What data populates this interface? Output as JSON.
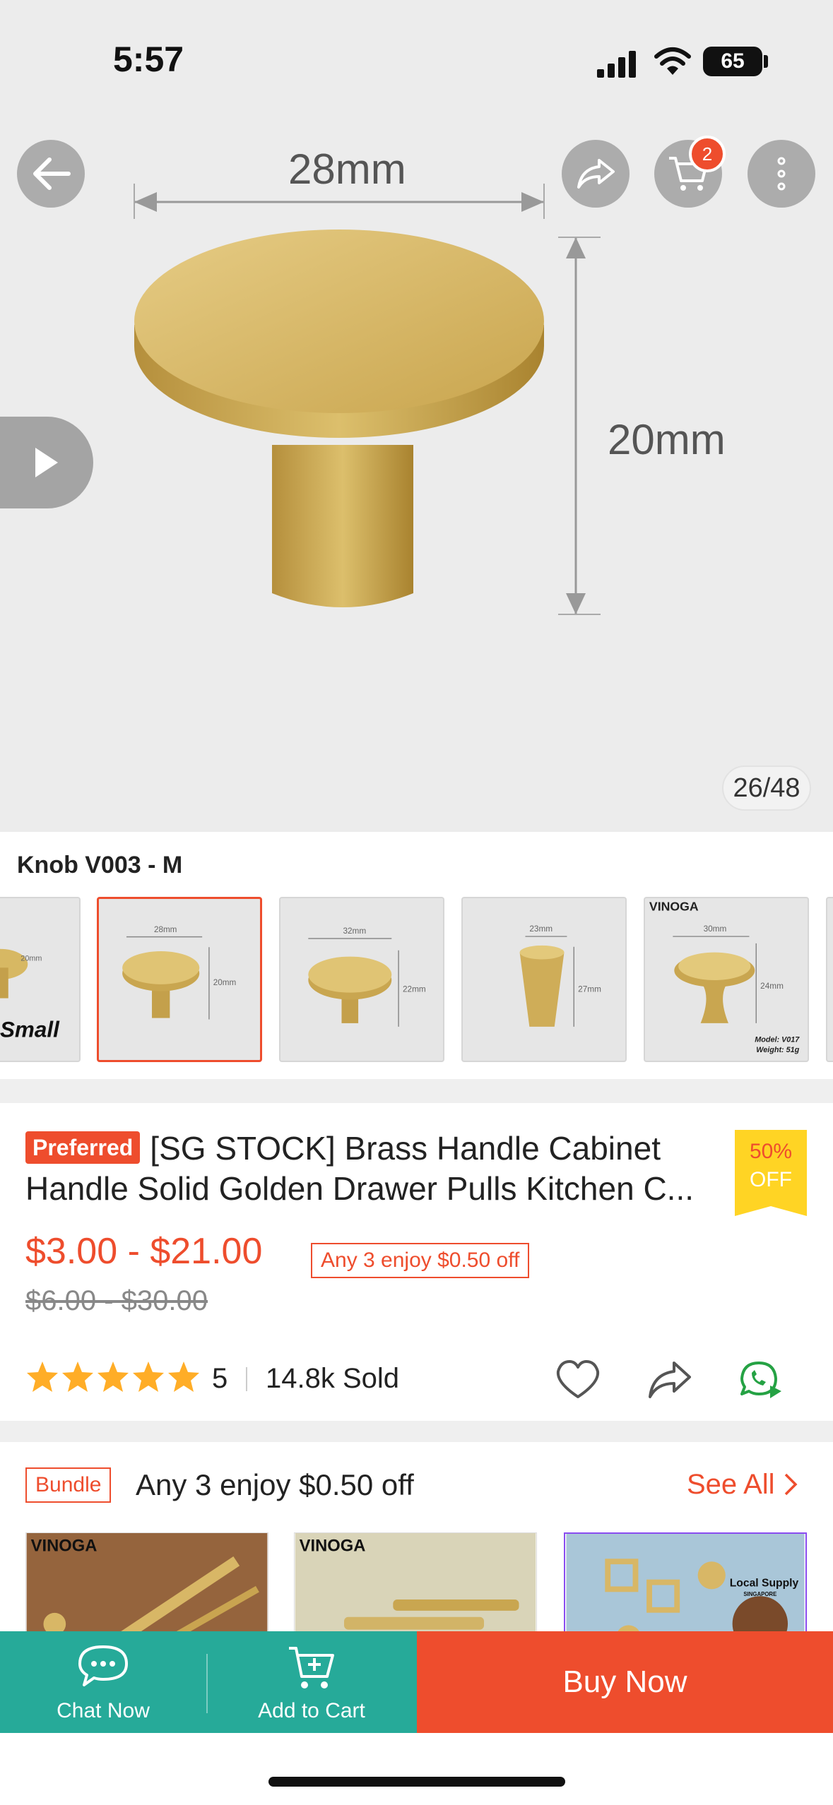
{
  "status_bar": {
    "time": "5:57",
    "battery": "65"
  },
  "hero": {
    "dimension_width_label": "28mm",
    "dimension_height_label": "20mm",
    "cart_count": "2",
    "image_counter": "26/48"
  },
  "variant": {
    "selected_name": "Knob V003 - M",
    "thumbnails": [
      {
        "label": "Small",
        "dims": "20mm"
      },
      {
        "dims_w": "28mm",
        "dims_h": "20mm"
      },
      {
        "dims_w": "32mm",
        "dims_h": "22mm"
      },
      {
        "dims_w": "23mm",
        "dims_h": "27mm"
      },
      {
        "brand": "VINOGA",
        "dims_w": "30mm",
        "dims_h": "24mm",
        "model": "Model: V017",
        "weight": "Weight: 51g"
      }
    ]
  },
  "product": {
    "badge": "Preferred",
    "title": "[SG STOCK] Brass Handle Cabinet Handle Solid Golden Drawer Pulls Kitchen C...",
    "discount_pct": "50%",
    "discount_off": "OFF",
    "price": "$3.00 - $21.00",
    "promo": "Any 3 enjoy $0.50 off",
    "old_price": "$6.00 - $30.00",
    "rating": "5",
    "sold": "14.8k Sold"
  },
  "bundle": {
    "badge": "Bundle",
    "title": "Any 3 enjoy $0.50 off",
    "see_all": "See All",
    "items": [
      {
        "brand": "VINOGA"
      },
      {
        "brand": "VINOGA"
      },
      {
        "brand": "Local Supply",
        "sub": "SINGAPORE"
      }
    ]
  },
  "bottom_bar": {
    "chat_label": "Chat Now",
    "cart_label": "Add to Cart",
    "buy_label": "Buy Now"
  },
  "colors": {
    "accent": "#ee4d2d",
    "teal": "#26aa99",
    "gold": "#d4b25a",
    "discount_yellow": "#ffd424",
    "whatsapp": "#25a244"
  }
}
